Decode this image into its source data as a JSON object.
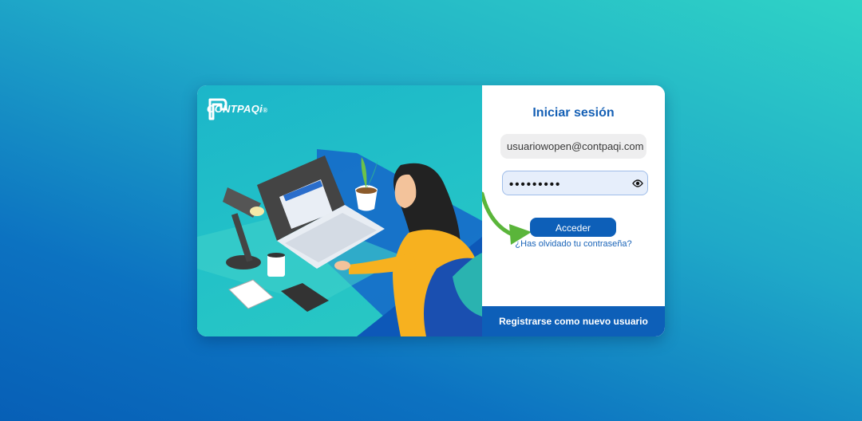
{
  "brand": {
    "name": "CONTPAQ",
    "suffix": "i",
    "mark": "®"
  },
  "login": {
    "title": "Iniciar sesión",
    "email_value": "usuariowopen@contpaqi.com",
    "password_mask": "•••••••••",
    "submit_label": "Acceder",
    "forgot_link": "¿Has olvidado tu contraseña?",
    "register_label": "Registrarse como nuevo usuario"
  },
  "icons": {
    "logo": "contpaqi-logo-icon",
    "show_password": "eye-icon",
    "pointer": "green-arrow-icon"
  },
  "colors": {
    "primary": "#0d5fb8",
    "title": "#1560b5",
    "arrow": "#5ab53a",
    "background_start": "#2fd3c6",
    "background_end": "#075fb6"
  }
}
